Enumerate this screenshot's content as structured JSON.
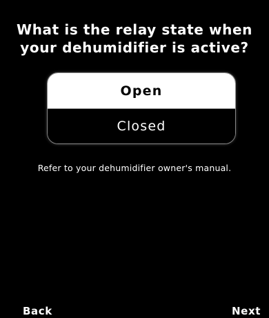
{
  "question": {
    "line1": "What is the relay state when",
    "line2": "your dehumidifier is active?"
  },
  "options": [
    {
      "label": "Open",
      "selected": true
    },
    {
      "label": "Closed",
      "selected": false
    }
  ],
  "hint": "Refer to your dehumidifier owner's manual.",
  "nav": {
    "back_label": "Back",
    "next_label": "Next"
  },
  "colors": {
    "background": "#000000",
    "text": "#ffffff",
    "selected_background": "#ffffff",
    "selected_text": "#000000",
    "border": "#8a8a8a"
  }
}
